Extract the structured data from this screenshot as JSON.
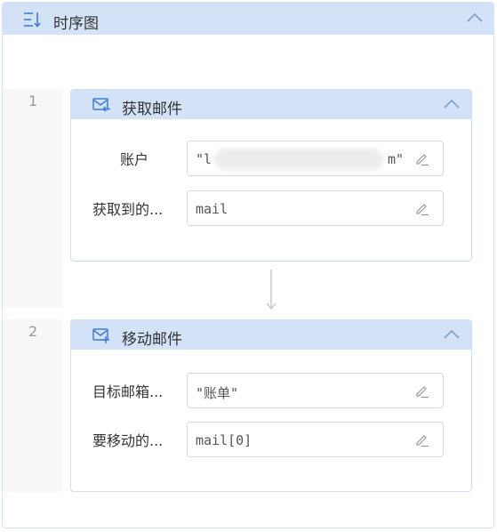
{
  "panel": {
    "title": "时序图"
  },
  "steps": [
    {
      "number": "1",
      "title": "获取邮件",
      "icon": "mail-receive-icon",
      "fields": [
        {
          "label": "账户",
          "value": "\"l",
          "value_end": "m\""
        },
        {
          "label": "获取到的...",
          "value": "mail"
        }
      ]
    },
    {
      "number": "2",
      "title": "移动邮件",
      "icon": "mail-move-icon",
      "fields": [
        {
          "label": "目标邮箱...",
          "value": "\"账单\""
        },
        {
          "label": "要移动的...",
          "value": "mail[0]"
        }
      ]
    }
  ],
  "colors": {
    "header_bg": "#d3e2f6",
    "accent": "#3d7ed8",
    "border": "#cfdff2"
  }
}
